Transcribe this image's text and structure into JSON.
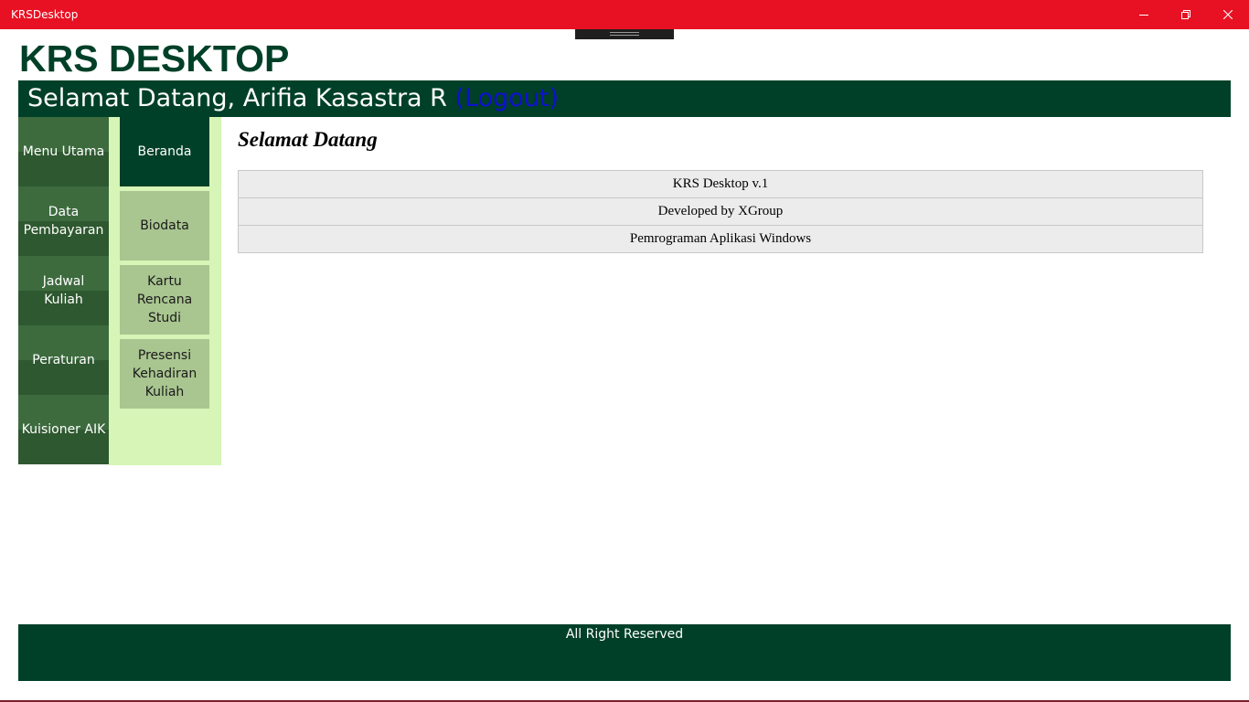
{
  "window": {
    "title": "KRSDesktop",
    "controls": [
      "minimize-icon",
      "restore-icon",
      "close-icon"
    ],
    "accent_color": "#e81123"
  },
  "header": {
    "app_title": "KRS DESKTOP",
    "welcome_text": "Selamat Datang, Arifia Kasastra R",
    "logout_label": "(Logout)",
    "bar_color": "#004028",
    "logout_color": "#1010d0"
  },
  "left_menu": {
    "items": [
      {
        "label": "Menu Utama"
      },
      {
        "label": "Data Pembayaran"
      },
      {
        "label": "Jadwal Kuliah"
      },
      {
        "label": "Peraturan"
      },
      {
        "label": "Kuisioner AIK"
      }
    ],
    "color": "#2e582f"
  },
  "sub_menu": {
    "items": [
      {
        "label": "Beranda",
        "active": true
      },
      {
        "label": "Biodata",
        "active": false
      },
      {
        "label": "Kartu Rencana Studi",
        "active": false
      },
      {
        "label": "Presensi Kehadiran Kuliah",
        "active": false
      }
    ],
    "background": "#d6f5b6",
    "item_color": "#a9c590"
  },
  "main": {
    "title": "Selamat Datang",
    "rows": [
      "KRS Desktop v.1",
      "Developed by XGroup",
      "Pemrograman Aplikasi Windows"
    ]
  },
  "footer": {
    "text": "All Right Reserved"
  }
}
